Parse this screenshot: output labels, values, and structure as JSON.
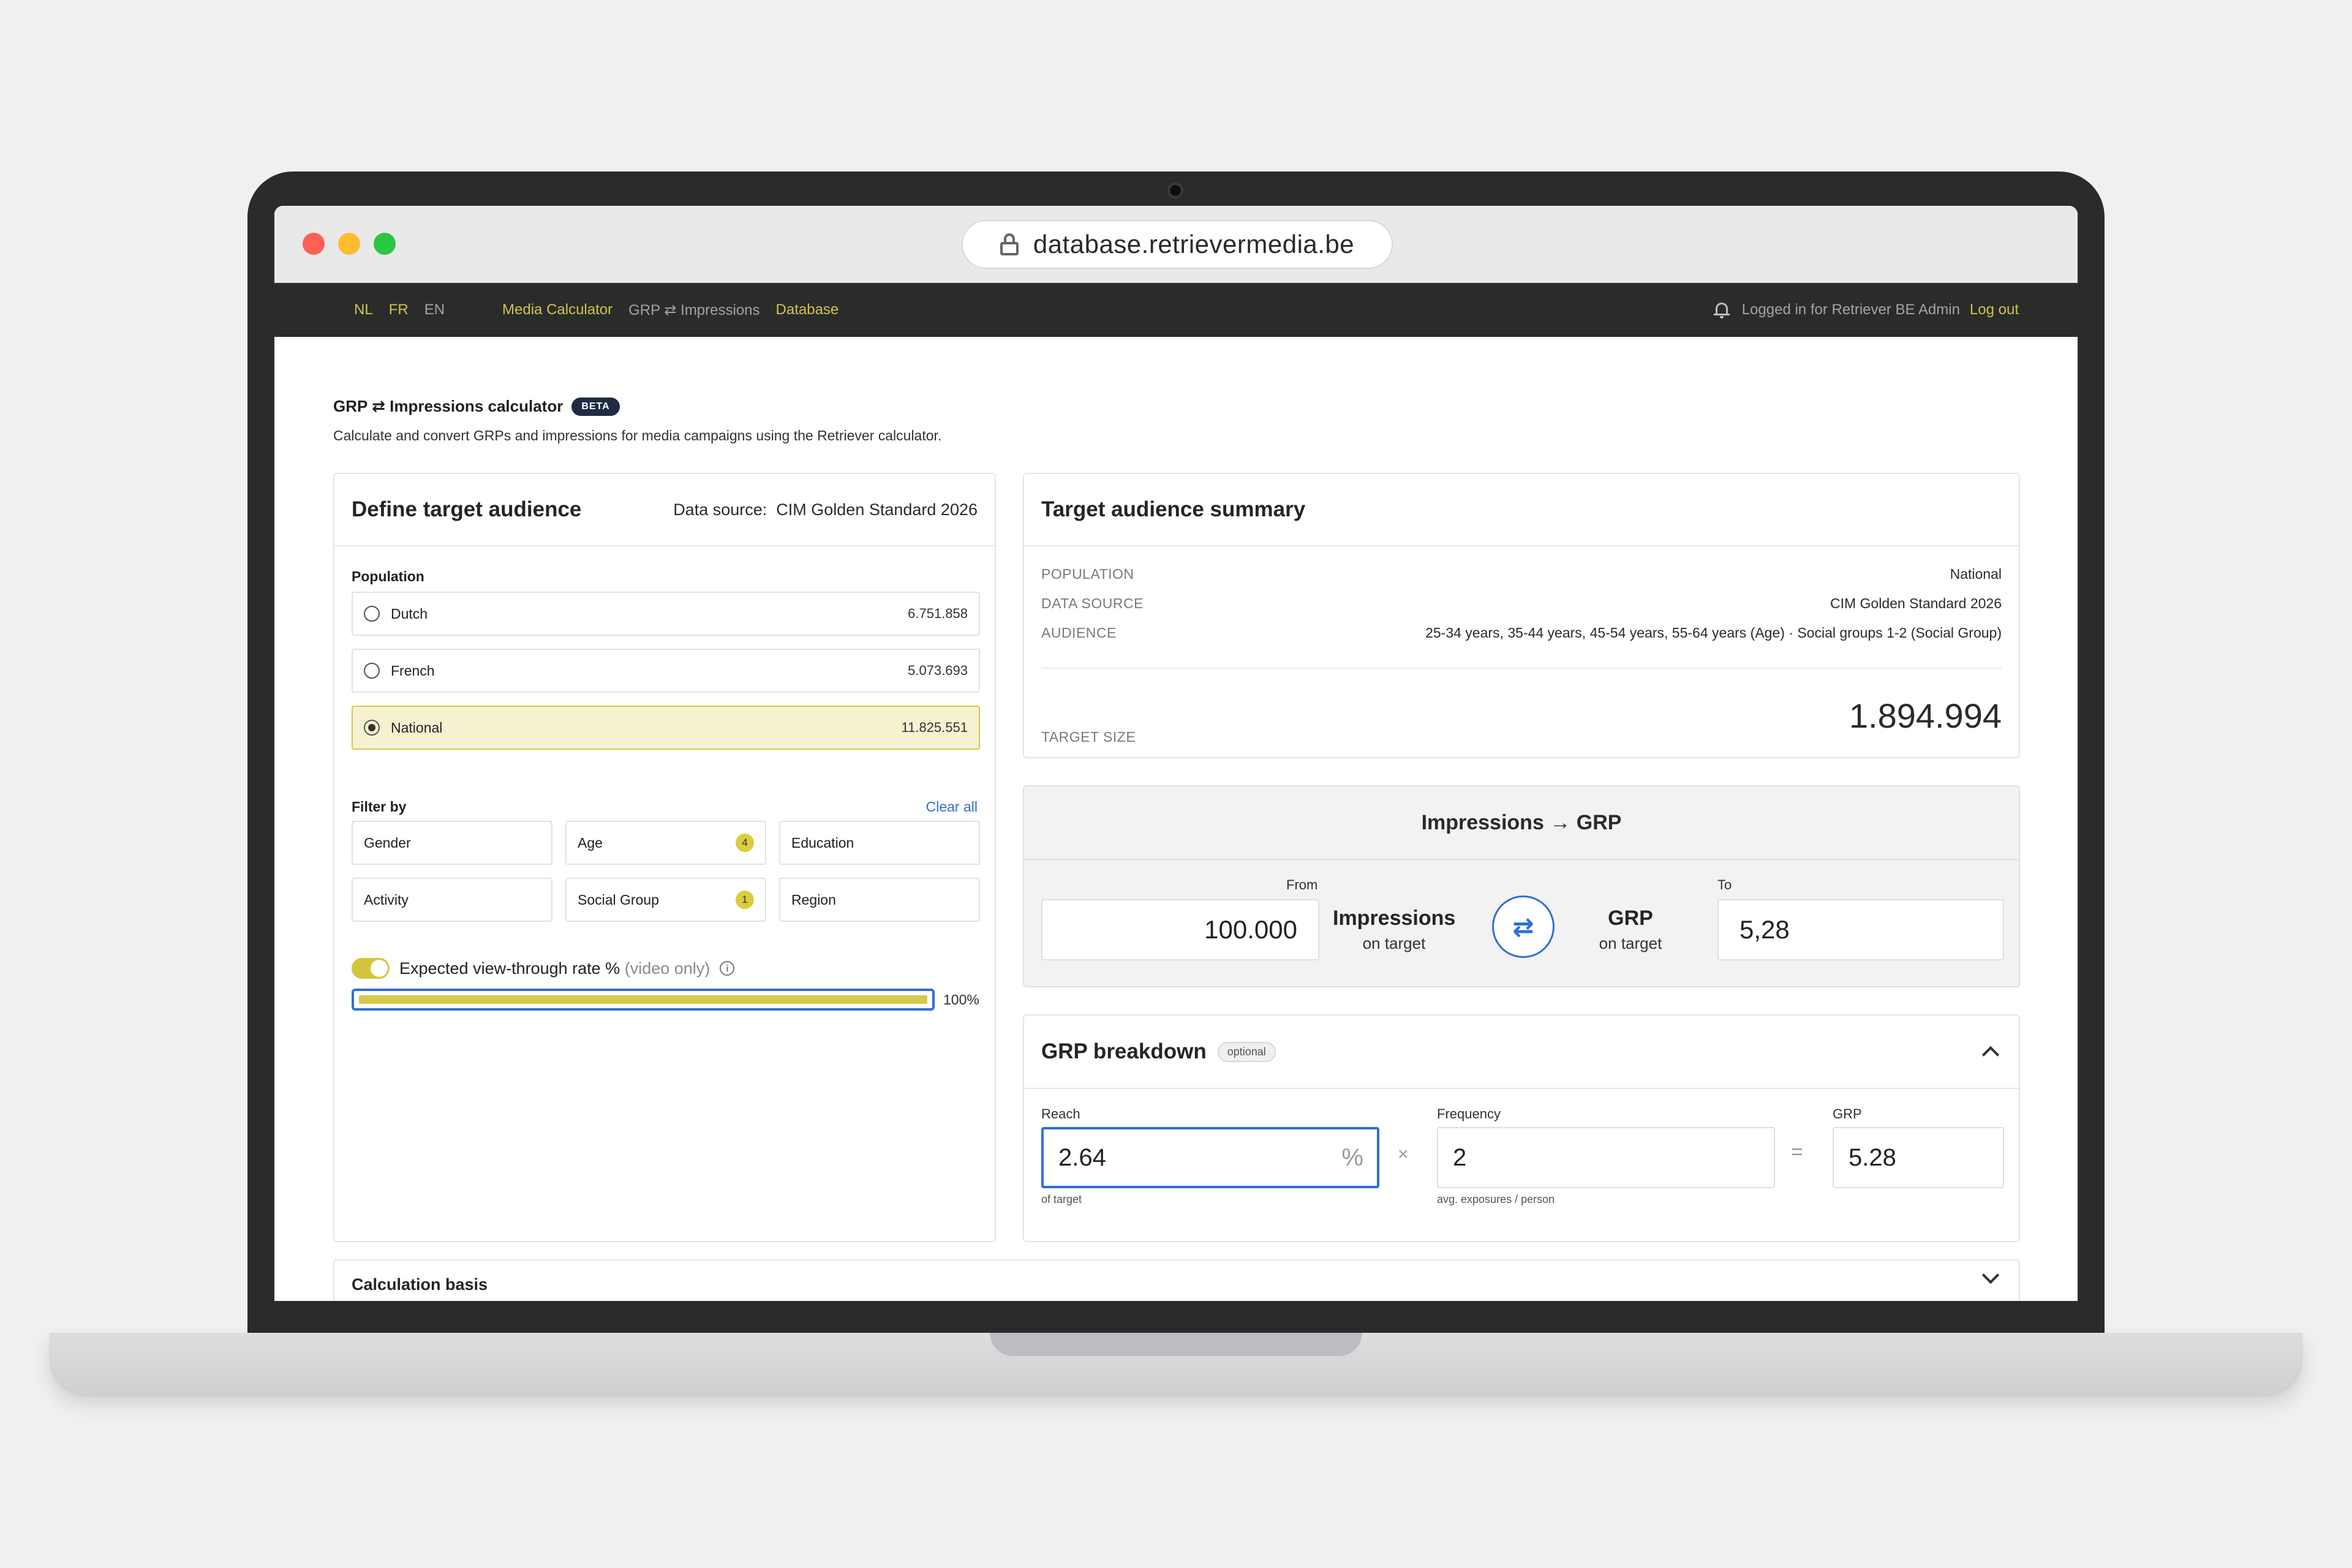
{
  "browser": {
    "url": "database.retrievermedia.be"
  },
  "navbar": {
    "languages": [
      {
        "label": "NL",
        "active": true
      },
      {
        "label": "FR",
        "active": true
      },
      {
        "label": "EN",
        "active": false
      }
    ],
    "links": [
      {
        "label": "Media Calculator",
        "active": true
      },
      {
        "label": "GRP ⇄ Impressions",
        "active": false
      },
      {
        "label": "Database",
        "active": true
      }
    ],
    "logged_in_text": "Logged in for Retriever BE Admin",
    "logout_label": "Log out"
  },
  "page": {
    "title": "GRP ⇄ Impressions calculator",
    "badge": "BETA",
    "subtitle": "Calculate and convert GRPs and impressions for media campaigns using the Retriever calculator."
  },
  "audience": {
    "title": "Define target audience",
    "data_source_label": "Data source:",
    "data_source_value": "CIM Golden Standard 2026",
    "population_label": "Population",
    "populations": [
      {
        "label": "Dutch",
        "value": "6.751.858",
        "selected": false
      },
      {
        "label": "French",
        "value": "5.073.693",
        "selected": false
      },
      {
        "label": "National",
        "value": "11.825.551",
        "selected": true
      }
    ],
    "filter_label": "Filter by",
    "clear_all": "Clear all",
    "filters": [
      {
        "label": "Gender",
        "count": ""
      },
      {
        "label": "Age",
        "count": "4"
      },
      {
        "label": "Education",
        "count": ""
      },
      {
        "label": "Activity",
        "count": ""
      },
      {
        "label": "Social Group",
        "count": "1"
      },
      {
        "label": "Region",
        "count": ""
      }
    ],
    "vtr_label": "Expected view-through rate %",
    "vtr_note": "(video only)",
    "vtr_enabled": true,
    "vtr_value_percent": 100,
    "vtr_display": "100%"
  },
  "summary": {
    "title": "Target audience summary",
    "rows": [
      {
        "key": "POPULATION",
        "value": "National"
      },
      {
        "key": "DATA SOURCE",
        "value": "CIM Golden Standard 2026"
      },
      {
        "key": "AUDIENCE",
        "value": "25-34 years, 35-44 years, 45-54 years, 55-64 years (Age) · Social groups 1-2 (Social Group)"
      }
    ],
    "target_size_label": "TARGET SIZE",
    "target_size_value": "1.894.994"
  },
  "converter": {
    "title": "Impressions → GRP",
    "from_label": "From",
    "to_label": "To",
    "from_value": "100.000",
    "to_value": "5,28",
    "from_metric": "Impressions",
    "from_metric_sub": "on target",
    "to_metric": "GRP",
    "to_metric_sub": "on target",
    "swap_icon": "swap-arrows-icon"
  },
  "breakdown": {
    "title": "GRP breakdown",
    "badge": "optional",
    "reach_label": "Reach",
    "reach_value": "2.64",
    "reach_unit": "%",
    "reach_hint": "of target",
    "times_sign": "×",
    "frequency_label": "Frequency",
    "frequency_value": "2",
    "frequency_hint": "avg. exposures / person",
    "equals_sign": "=",
    "grp_label": "GRP",
    "grp_value": "5.28"
  },
  "calculation_basis": {
    "title": "Calculation basis"
  },
  "colors": {
    "accent_yellow": "#d2c53a",
    "link_blue": "#2f6fd6",
    "navbar_bg": "#2b2b2b",
    "selected_bg": "#f6f1d0"
  }
}
